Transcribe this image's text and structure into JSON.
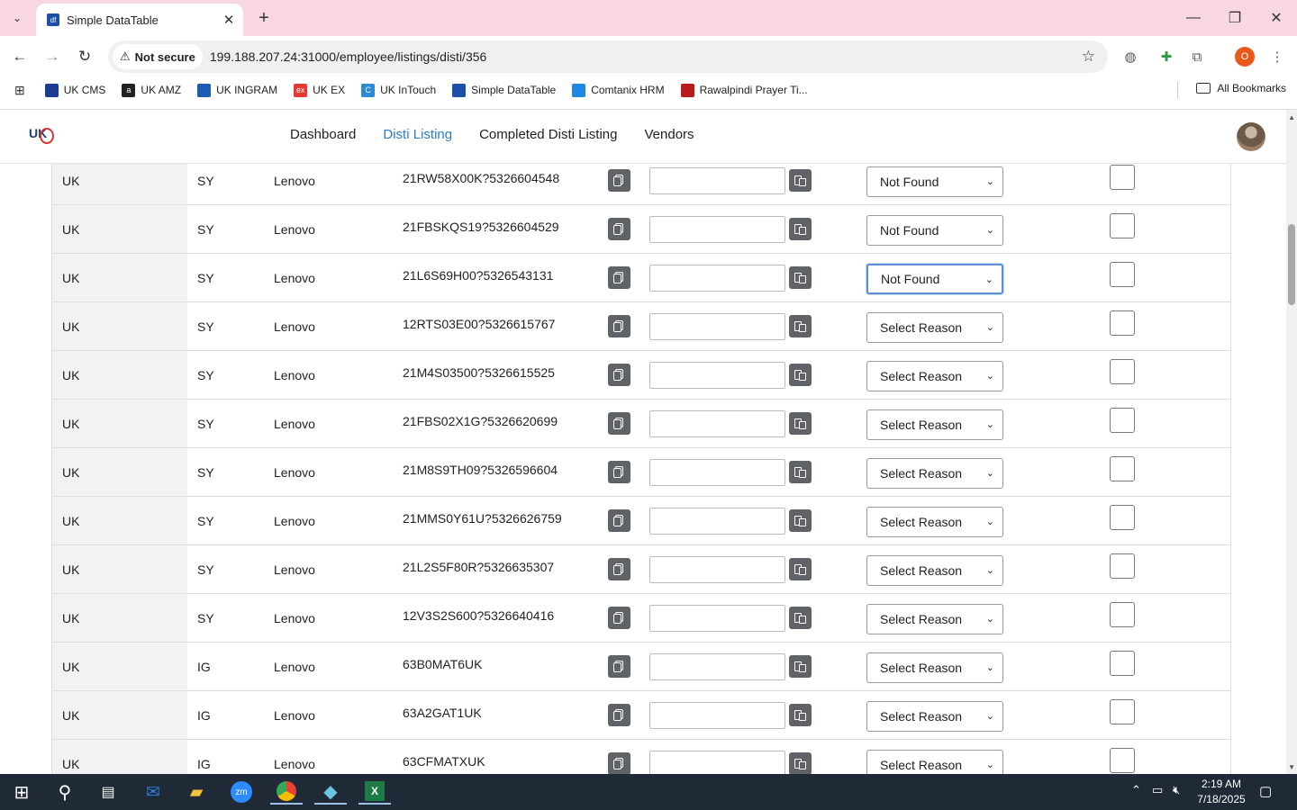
{
  "browser": {
    "tab_title": "Simple DataTable",
    "tab_favicon": "df",
    "security_label": "Not secure",
    "url": "199.188.207.24:31000/employee/listings/disti/356",
    "profile_initial": "O",
    "bookmarks": [
      {
        "label": "UK CMS",
        "color": "#1b3c8f",
        "glyph": ""
      },
      {
        "label": "UK AMZ",
        "color": "#222222",
        "glyph": "a"
      },
      {
        "label": "UK INGRAM",
        "color": "#1e5bb5",
        "glyph": ""
      },
      {
        "label": "UK EX",
        "color": "#e53935",
        "glyph": "ex"
      },
      {
        "label": "UK InTouch",
        "color": "#2b8ad8",
        "glyph": "C"
      },
      {
        "label": "Simple DataTable",
        "color": "#1b4fa8",
        "glyph": ""
      },
      {
        "label": "Comtanix HRM",
        "color": "#1e88e5",
        "glyph": ""
      },
      {
        "label": "Rawalpindi Prayer Ti...",
        "color": "#b71c1c",
        "glyph": ""
      }
    ],
    "all_bookmarks": "All Bookmarks"
  },
  "app": {
    "logo_text": "UK",
    "nav": {
      "dashboard": "Dashboard",
      "disti_listing": "Disti Listing",
      "completed": "Completed Disti Listing",
      "vendors": "Vendors"
    },
    "rows": [
      {
        "country": "UK",
        "disti": "SY",
        "brand": "Lenovo",
        "part": "21RW58X00K?5326604548",
        "reason": "Not Found"
      },
      {
        "country": "UK",
        "disti": "SY",
        "brand": "Lenovo",
        "part": "21FBSKQS19?5326604529",
        "reason": "Not Found"
      },
      {
        "country": "UK",
        "disti": "SY",
        "brand": "Lenovo",
        "part": "21L6S69H00?5326543131",
        "reason": "Not Found"
      },
      {
        "country": "UK",
        "disti": "SY",
        "brand": "Lenovo",
        "part": "12RTS03E00?5326615767",
        "reason": "Select Reason"
      },
      {
        "country": "UK",
        "disti": "SY",
        "brand": "Lenovo",
        "part": "21M4S03500?5326615525",
        "reason": "Select Reason"
      },
      {
        "country": "UK",
        "disti": "SY",
        "brand": "Lenovo",
        "part": "21FBS02X1G?5326620699",
        "reason": "Select Reason"
      },
      {
        "country": "UK",
        "disti": "SY",
        "brand": "Lenovo",
        "part": "21M8S9TH09?5326596604",
        "reason": "Select Reason"
      },
      {
        "country": "UK",
        "disti": "SY",
        "brand": "Lenovo",
        "part": "21MMS0Y61U?5326626759",
        "reason": "Select Reason"
      },
      {
        "country": "UK",
        "disti": "SY",
        "brand": "Lenovo",
        "part": "21L2S5F80R?5326635307",
        "reason": "Select Reason"
      },
      {
        "country": "UK",
        "disti": "SY",
        "brand": "Lenovo",
        "part": "12V3S2S600?5326640416",
        "reason": "Select Reason"
      },
      {
        "country": "UK",
        "disti": "IG",
        "brand": "Lenovo",
        "part": "63B0MAT6UK",
        "reason": "Select Reason"
      },
      {
        "country": "UK",
        "disti": "IG",
        "brand": "Lenovo",
        "part": "63A2GAT1UK",
        "reason": "Select Reason"
      },
      {
        "country": "UK",
        "disti": "IG",
        "brand": "Lenovo",
        "part": "63CFMATXUK",
        "reason": "Select Reason"
      }
    ]
  },
  "taskbar": {
    "time": "2:19 AM",
    "date": "7/18/2025"
  }
}
